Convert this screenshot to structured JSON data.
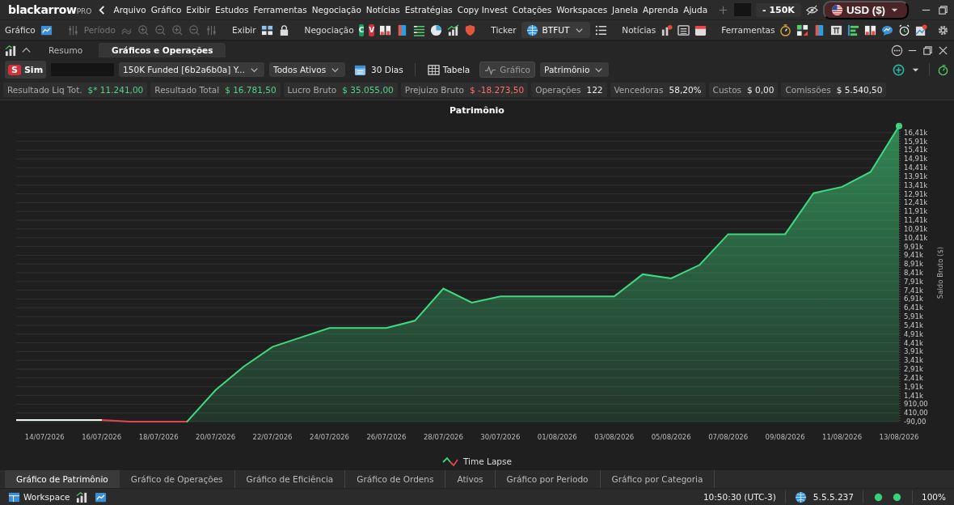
{
  "app": {
    "brand": "blackarrow",
    "edition": "PRO",
    "menu": [
      "Arquivo",
      "Gráfico",
      "Exibir",
      "Estudos",
      "Ferramentas",
      "Negociação",
      "Notícias",
      "Estratégias",
      "Copy Invest",
      "Cotações",
      "Workspaces",
      "Janela",
      "Aprenda",
      "Ajuda"
    ],
    "balance": "- 150K",
    "currency": "USD ($)"
  },
  "toolbar": {
    "chart_label": "Gráfico",
    "period_label": "Período",
    "period_disabled": true,
    "view_label": "Exibir",
    "trading_label": "Negociação",
    "trading_buttons": [
      {
        "label": "C",
        "kind": "buy"
      },
      {
        "label": "V",
        "kind": "sell"
      }
    ],
    "ticker_label": "Ticker",
    "ticker": "BTFUT",
    "news_label": "Notícias",
    "tools_label": "Ferramentas"
  },
  "panel": {
    "tabs": [
      {
        "label": "Resumo",
        "selected": false
      },
      {
        "label": "Gráficos e Operações",
        "selected": true
      }
    ]
  },
  "filters": {
    "mode_badge": "S",
    "mode": "Sim",
    "account": "150K Funded [6b2a6b0a] Y...",
    "assets": "Todos Ativos",
    "period": "30 Dias",
    "views": [
      {
        "label": "Tabela",
        "kind": "table",
        "selected": false
      },
      {
        "label": "Gráfico",
        "kind": "chart",
        "selected": true
      }
    ],
    "metric": "Patrimônio"
  },
  "stats": [
    {
      "label": "Resultado Liq Tot.",
      "value": "$* 11.241,00",
      "color": "#4fd48a"
    },
    {
      "label": "Resultado Total",
      "value": "$ 16.781,50",
      "color": "#4fd48a"
    },
    {
      "label": "Lucro Bruto",
      "value": "$ 35.055,00",
      "color": "#4fd48a"
    },
    {
      "label": "Prejuizo Bruto",
      "value": "$ -18.273,50",
      "color": "#ff6f6f"
    },
    {
      "label": "Operações",
      "value": "122",
      "color": "#eeeeee"
    },
    {
      "label": "Vencedoras",
      "value": "58,20%",
      "color": "#eeeeee"
    },
    {
      "label": "Custos",
      "value": "$ 0,00",
      "color": "#eeeeee"
    },
    {
      "label": "Comissões",
      "value": "$ 5.540,50",
      "color": "#eeeeee"
    }
  ],
  "chart": {
    "chart_data": {
      "type": "area",
      "title": "Patrimônio",
      "ylabel": "Saldo Bruto ($)",
      "categories": [
        null,
        "14/07/2026",
        null,
        "16/07/2026",
        null,
        "18/07/2026",
        null,
        "20/07/2026",
        null,
        "22/07/2026",
        null,
        "24/07/2026",
        null,
        "26/07/2026",
        null,
        "28/07/2026",
        null,
        "30/07/2026",
        null,
        "01/08/2026",
        null,
        "03/08/2026",
        null,
        "05/08/2026",
        null,
        "07/08/2026",
        null,
        "09/08/2026",
        null,
        "11/08/2026",
        null,
        "13/08/2026"
      ],
      "series": [
        {
          "name": "Time Lapse",
          "color": "#3fd97f",
          "values": [
            0,
            0,
            0,
            0,
            -90,
            -90,
            -90,
            1710,
            3060,
            4180,
            4720,
            5260,
            5260,
            5260,
            5670,
            7510,
            6700,
            7060,
            7060,
            7060,
            7060,
            7060,
            8320,
            8090,
            8860,
            10610,
            10610,
            10610,
            12950,
            13310,
            14160,
            16780
          ]
        }
      ],
      "ylim": [
        -90,
        16910
      ],
      "grid": true,
      "yticks": [
        {
          "value": -90,
          "label": "-90,00"
        },
        {
          "value": 410,
          "label": "410,00"
        },
        {
          "value": 910,
          "label": "910,00"
        },
        {
          "value": 1410,
          "label": "1,41k"
        },
        {
          "value": 1910,
          "label": "1,91k"
        },
        {
          "value": 2410,
          "label": "2,41k"
        },
        {
          "value": 2910,
          "label": "2,91k"
        },
        {
          "value": 3410,
          "label": "3,41k"
        },
        {
          "value": 3910,
          "label": "3,91k"
        },
        {
          "value": 4410,
          "label": "4,41k"
        },
        {
          "value": 4910,
          "label": "4,91k"
        },
        {
          "value": 5410,
          "label": "5,41k"
        },
        {
          "value": 5910,
          "label": "5,91k"
        },
        {
          "value": 6410,
          "label": "6,41k"
        },
        {
          "value": 6910,
          "label": "6,91k"
        },
        {
          "value": 7410,
          "label": "7,41k"
        },
        {
          "value": 7910,
          "label": "7,91k"
        },
        {
          "value": 8410,
          "label": "8,41k"
        },
        {
          "value": 8910,
          "label": "8,91k"
        },
        {
          "value": 9410,
          "label": "9,41k"
        },
        {
          "value": 9910,
          "label": "9,91k"
        },
        {
          "value": 10410,
          "label": "10,41k"
        },
        {
          "value": 10910,
          "label": "10,91k"
        },
        {
          "value": 11410,
          "label": "11,41k"
        },
        {
          "value": 11910,
          "label": "11,91k"
        },
        {
          "value": 12410,
          "label": "12,41k"
        },
        {
          "value": 12910,
          "label": "12,91k"
        },
        {
          "value": 13410,
          "label": "13,41k"
        },
        {
          "value": 13910,
          "label": "13,91k"
        },
        {
          "value": 14410,
          "label": "14,41k"
        },
        {
          "value": 14910,
          "label": "14,91k"
        },
        {
          "value": 15410,
          "label": "15,41k"
        },
        {
          "value": 15910,
          "label": "15,91k"
        },
        {
          "value": 16410,
          "label": "16,41k"
        }
      ]
    }
  },
  "bottom_tabs": [
    {
      "label": "Gráfico de Patrimônio",
      "selected": true
    },
    {
      "label": "Gráfico de Operações",
      "selected": false
    },
    {
      "label": "Gráfico de Eficiência",
      "selected": false
    },
    {
      "label": "Gráfico de Ordens",
      "selected": false
    },
    {
      "label": "Ativos",
      "selected": false
    },
    {
      "label": "Gráfico por Periodo",
      "selected": false
    },
    {
      "label": "Gráfico por Categoria",
      "selected": false
    }
  ],
  "status_bar": {
    "workspace": "Workspace",
    "time": "10:50:30 (UTC-3)",
    "version": "5.5.5.237",
    "zoom": "100%"
  }
}
